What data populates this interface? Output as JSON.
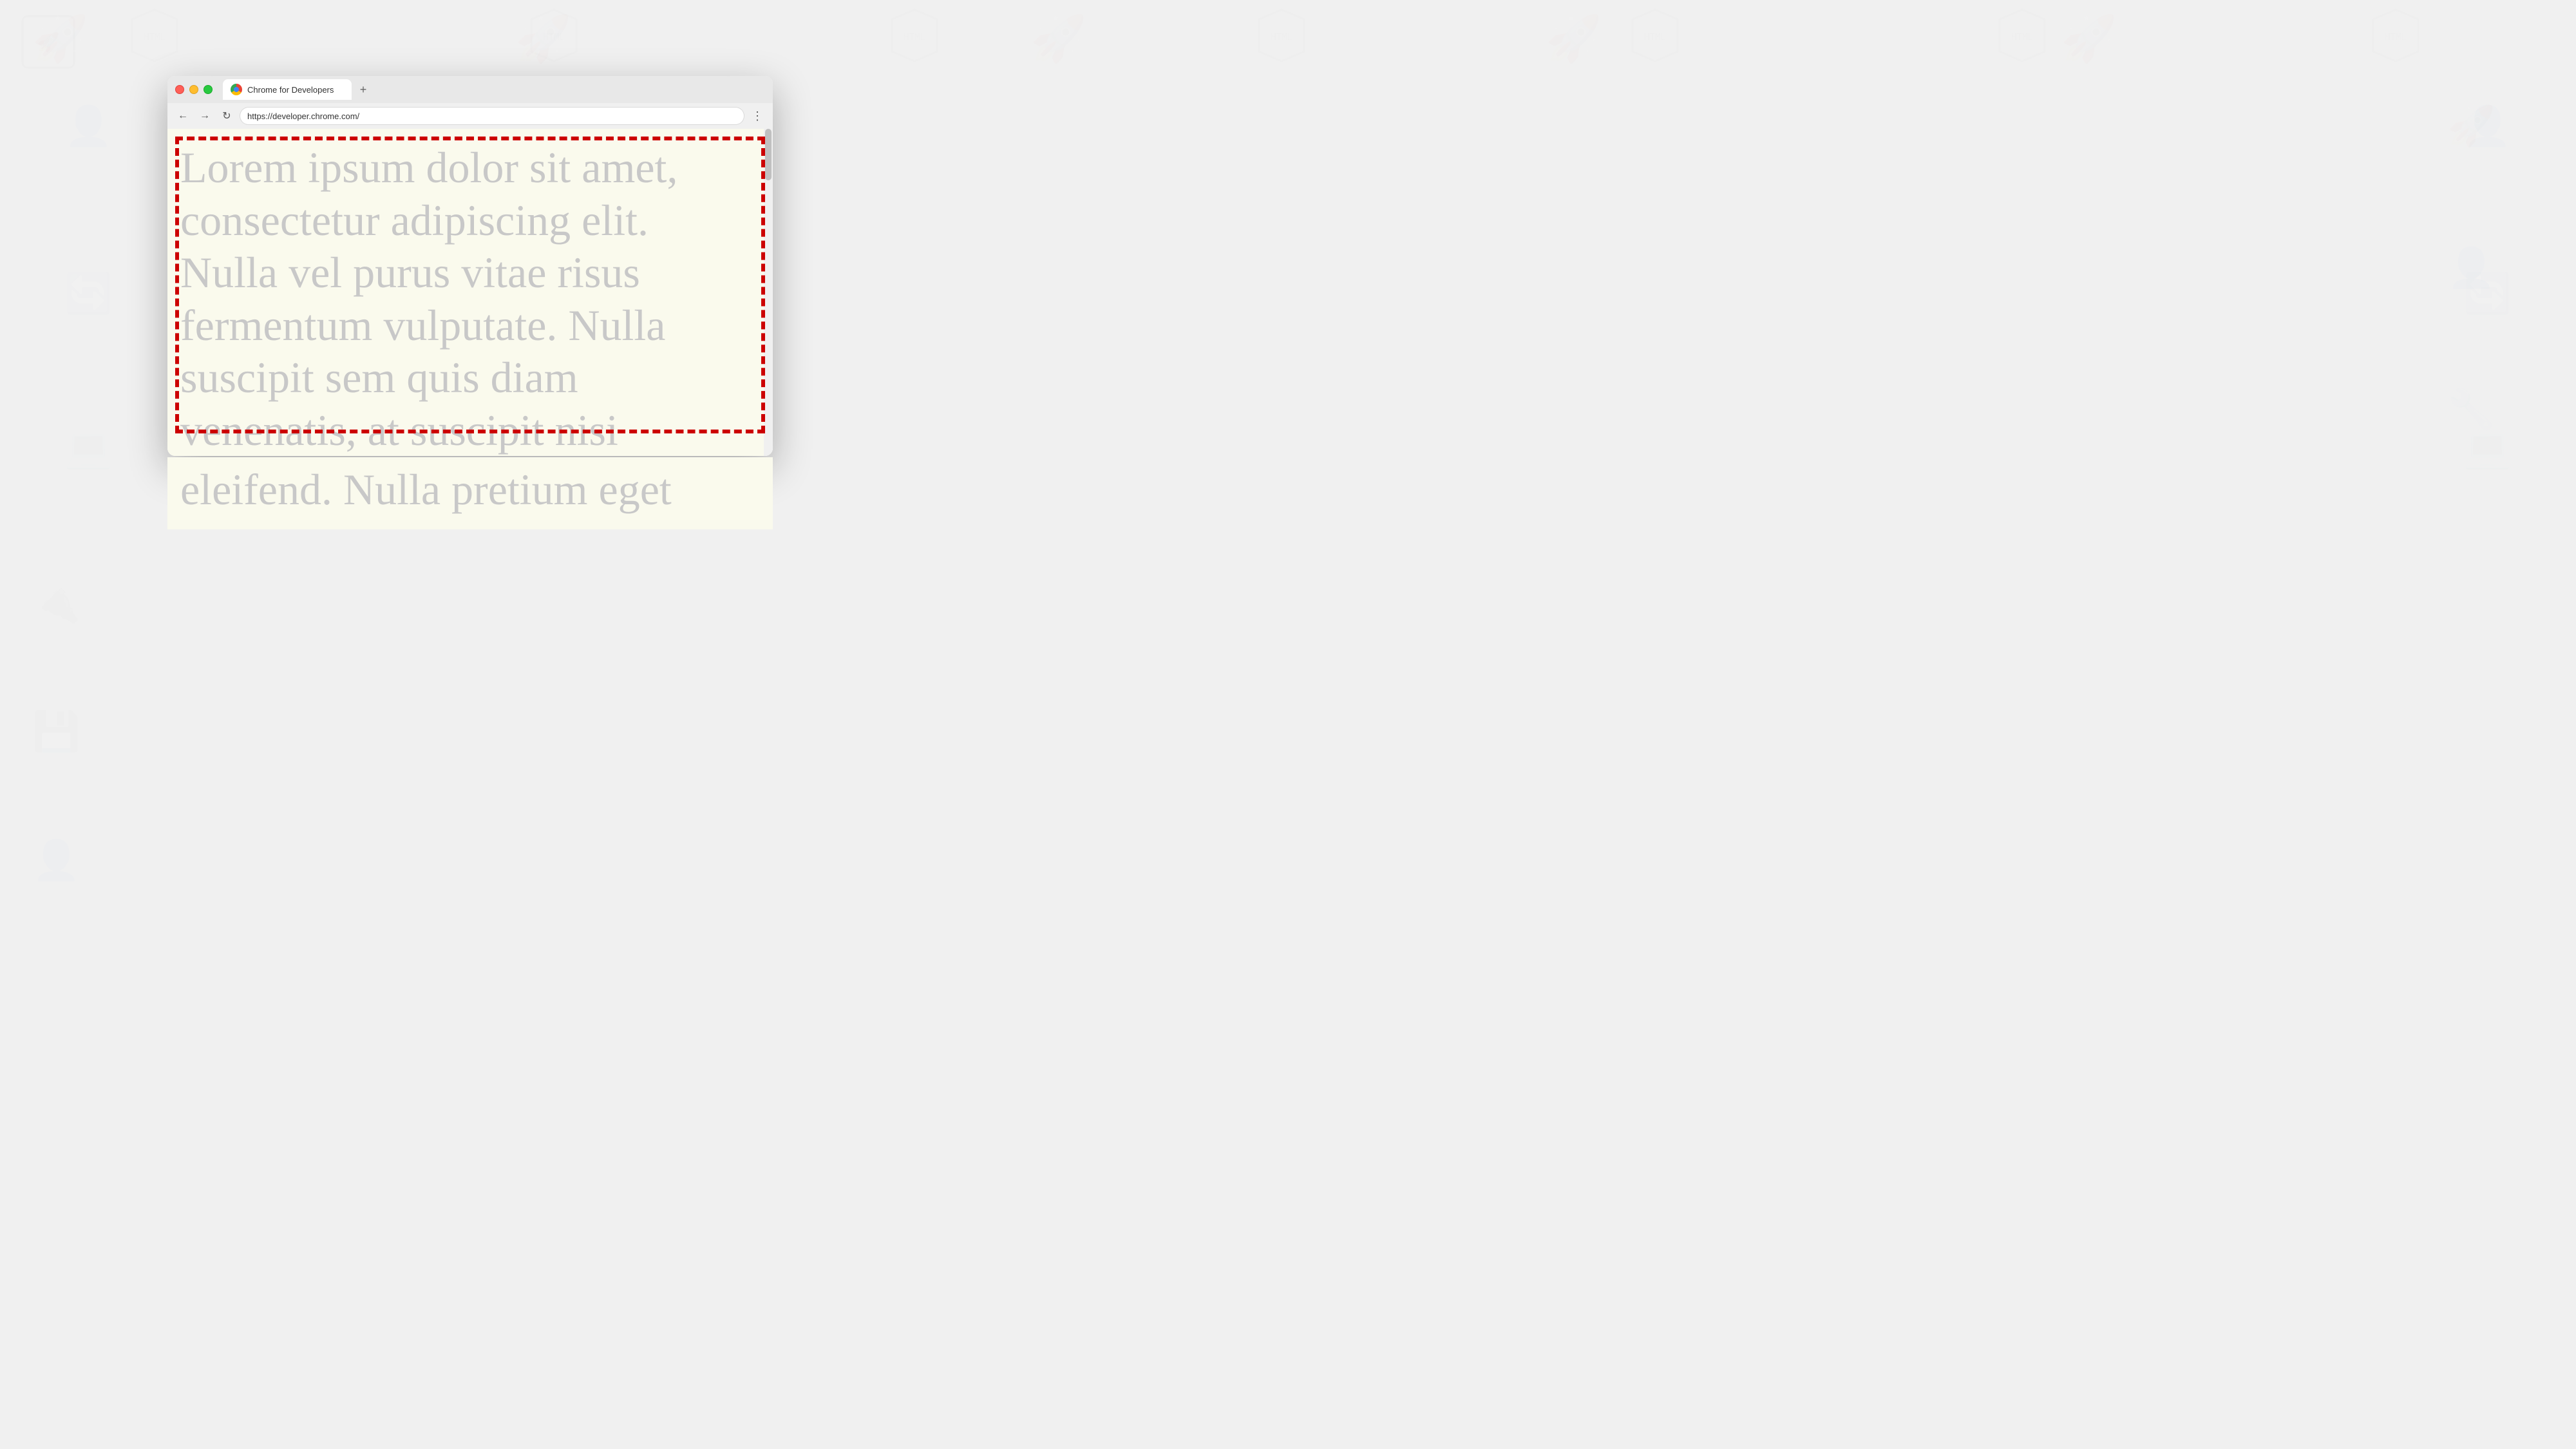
{
  "background": {
    "color": "#f0f0f0"
  },
  "browser": {
    "tab_title": "Chrome for Developers",
    "tab_new_label": "+",
    "url": "https://developer.chrome.com/",
    "nav": {
      "back_label": "←",
      "forward_label": "→",
      "reload_label": "↻",
      "menu_label": "⋮"
    }
  },
  "page": {
    "background_color": "#fafaed",
    "lorem_text": "Lorem ipsum dolor sit amet, consectetur adipiscing elit. Nulla vel purus vitae risus fermentum vulputate. Nulla suscipit sem quis diam venenatis, at suscipit nisi eleifend. Nulla pretium eget",
    "border_color": "#cc0000"
  }
}
